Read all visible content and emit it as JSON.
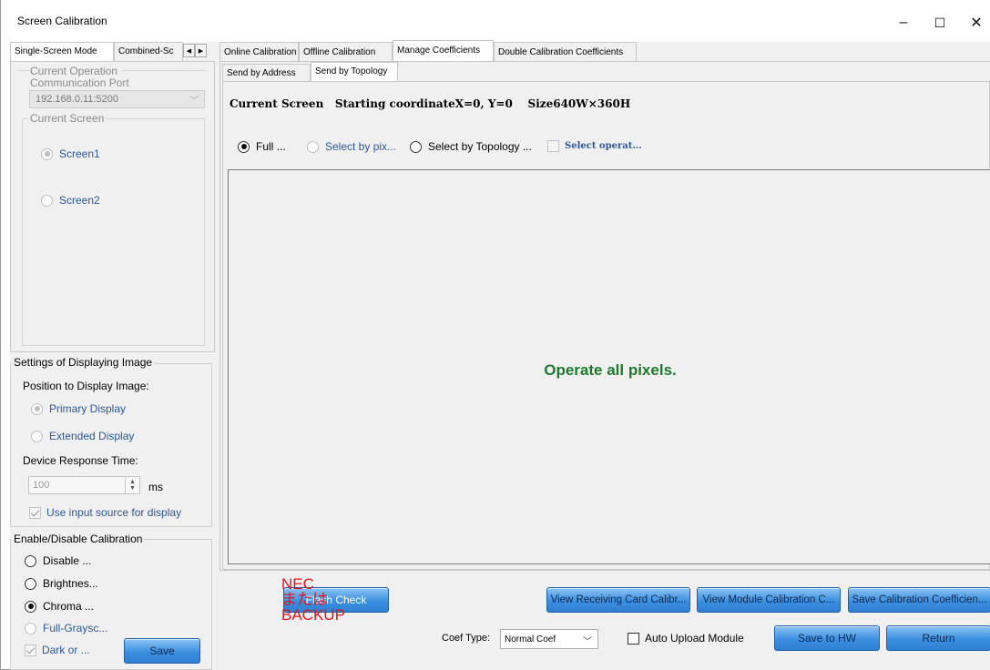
{
  "window": {
    "title": "Screen Calibration",
    "controls": [
      "–",
      "☐",
      "✕"
    ]
  },
  "left_tabs": {
    "single": "Single-Screen Mode",
    "combined": "Combined-Sc"
  },
  "current_operation": {
    "label": "Current Operation",
    "port_label": "Communication Port",
    "port_value": "192.168.0.11:5200"
  },
  "current_screen": {
    "label": "Current Screen",
    "screens": [
      "Screen1",
      "Screen2"
    ]
  },
  "display_settings": {
    "label": "Settings of Displaying Image",
    "position_label": "Position to Display Image:",
    "primary": "Primary Display",
    "extended": "Extended Display",
    "response_label": "Device Response Time:",
    "response_value": "100",
    "response_unit": "ms",
    "use_input": "Use input source for display"
  },
  "calibration": {
    "label": "Enable/Disable Calibration",
    "options": [
      "Disable ...",
      "Brightnes...",
      "Chroma ...",
      "Full-Graysc..."
    ],
    "dark": "Dark or ...",
    "save": "Save"
  },
  "right_tabs": [
    "Online Calibration",
    "Offline Calibration",
    "Manage Coefficients",
    "Double Calibration Coefficients"
  ],
  "sub_tabs": [
    "Send by Address",
    "Send by Topology"
  ],
  "screen_info": "Current Screen   Starting coordinateX=0, Y=0    Size640W×360H",
  "select_modes": {
    "full": "Full ...",
    "by_pixel": "Select by pix...",
    "by_topology": "Select by Topology ...",
    "operate": "Select operat..."
  },
  "canvas_message": "Operate all pixels.",
  "buttons": {
    "flash_check": "Flash Check",
    "view_receiving": "View Receiving Card Calibr...",
    "view_module": "View Module Calibration C...",
    "save_coef": "Save Calibration Coefficien...",
    "save_hw": "Save to HW",
    "return": "Return"
  },
  "coef": {
    "label": "Coef Type:",
    "value": "Normal Coef",
    "auto_upload": "Auto Upload Module"
  },
  "annotation": "NEC\nまたは\nBACKUP"
}
